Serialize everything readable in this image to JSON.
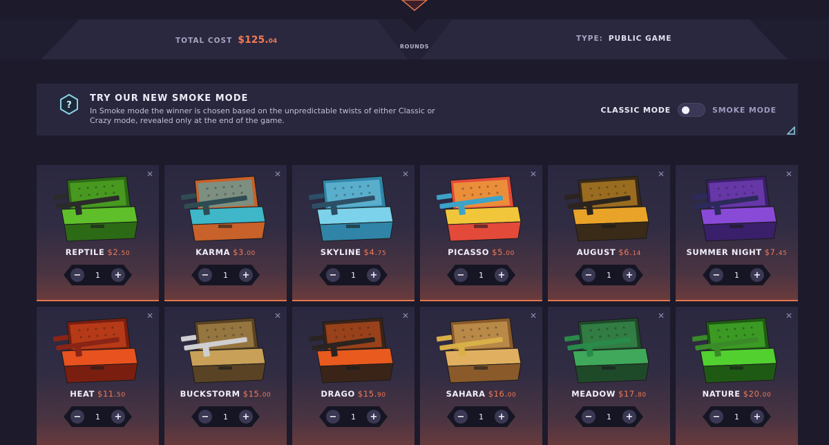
{
  "stats": {
    "total_cost_label": "TOTAL COST",
    "total_cost_main": "$125.",
    "total_cost_cents": "04",
    "rounds_label": "ROUNDS",
    "type_label": "TYPE:",
    "type_value": "PUBLIC GAME"
  },
  "smoke_banner": {
    "title": "TRY OUR NEW SMOKE MODE",
    "description": "In Smoke mode the winner is chosen based on the unpredictable twists of either Classic or Crazy mode, revealed only at the end of the game.",
    "classic_label": "CLASSIC MODE",
    "smoke_label": "SMOKE MODE"
  },
  "qty_controls": {
    "minus": "−",
    "plus": "+",
    "remove": "✕"
  },
  "cases": [
    {
      "name": "REPTILE",
      "price_main": "$2.",
      "price_cents": "50",
      "qty": "1",
      "primary": "#5fbf2a",
      "secondary": "#2d6a16",
      "item": "#2b2b2b"
    },
    {
      "name": "KARMA",
      "price_main": "$3.",
      "price_cents": "00",
      "qty": "1",
      "primary": "#3fb7c8",
      "secondary": "#c8612a",
      "item": "#2f4c52"
    },
    {
      "name": "SKYLINE",
      "price_main": "$4.",
      "price_cents": "75",
      "qty": "1",
      "primary": "#7cd2ea",
      "secondary": "#2f84a8",
      "item": "#2d4f66"
    },
    {
      "name": "PICASSO",
      "price_main": "$5.",
      "price_cents": "00",
      "qty": "1",
      "primary": "#f2c63a",
      "secondary": "#e34a3a",
      "item": "#3ca3c9"
    },
    {
      "name": "AUGUST",
      "price_main": "$6.",
      "price_cents": "14",
      "qty": "1",
      "primary": "#e8a328",
      "secondary": "#3a2a18",
      "item": "#2b241e"
    },
    {
      "name": "SUMMER NIGHT",
      "price_main": "$7.",
      "price_cents": "45",
      "qty": "1",
      "primary": "#8a4ad8",
      "secondary": "#3a1f6a",
      "item": "#2c2a5a"
    },
    {
      "name": "HEAT",
      "price_main": "$11.",
      "price_cents": "50",
      "qty": "1",
      "primary": "#e8521e",
      "secondary": "#7a1e10",
      "item": "#8a2416"
    },
    {
      "name": "BUCKSTORM",
      "price_main": "$15.",
      "price_cents": "00",
      "qty": "1",
      "primary": "#c8a058",
      "secondary": "#5a4324",
      "item": "#cfcfd2"
    },
    {
      "name": "DRAGO",
      "price_main": "$15.",
      "price_cents": "90",
      "qty": "1",
      "primary": "#e85a1e",
      "secondary": "#3a2418",
      "item": "#2a2420"
    },
    {
      "name": "SAHARA",
      "price_main": "$16.",
      "price_cents": "00",
      "qty": "1",
      "primary": "#e0b060",
      "secondary": "#8a5a2a",
      "item": "#d8b048"
    },
    {
      "name": "MEADOW",
      "price_main": "$17.",
      "price_cents": "80",
      "qty": "1",
      "primary": "#3fa85a",
      "secondary": "#1f4a2a",
      "item": "#2a8a4a"
    },
    {
      "name": "NATURE",
      "price_main": "$20.",
      "price_cents": "00",
      "qty": "1",
      "primary": "#52d030",
      "secondary": "#1f5a14",
      "item": "#3a8a2a"
    }
  ]
}
